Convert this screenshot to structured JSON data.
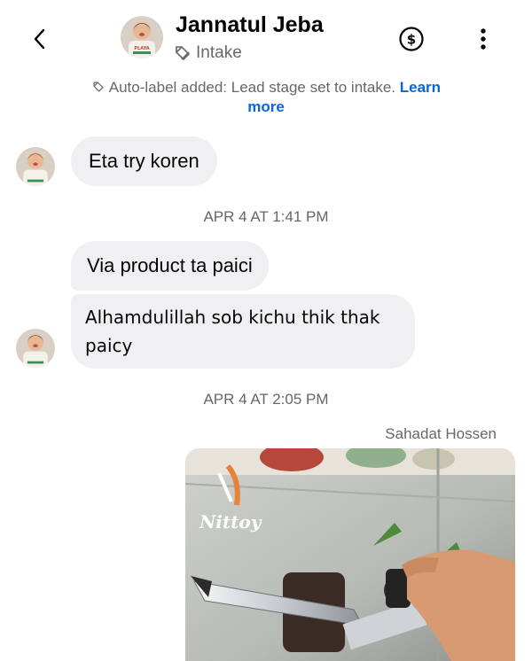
{
  "header": {
    "contact_name": "Jannatul Jeba",
    "stage_label": "Intake"
  },
  "system_note": {
    "text": "Auto-label added: Lead stage set to intake.",
    "link_text": "Learn more"
  },
  "messages": [
    {
      "text": "Eta try koren"
    },
    {
      "timestamp": "APR 4 AT 1:41 PM"
    },
    {
      "text": "Via product ta paici"
    },
    {
      "text": "Alhamdulillah sob kichu thik thak paicy"
    },
    {
      "timestamp": "APR 4 AT 2:05 PM"
    },
    {
      "sender": "Sahadat Hossen",
      "image_watermark": "Nittoy"
    }
  ],
  "icons": {
    "back": "chevron-left-icon",
    "label": "tag-icon",
    "pay": "dollar-circle-icon",
    "more": "vertical-ellipsis-icon"
  },
  "colors": {
    "link": "#0a66d8",
    "bubble_bg": "#f0f0f2",
    "secondary_text": "#65676b"
  }
}
